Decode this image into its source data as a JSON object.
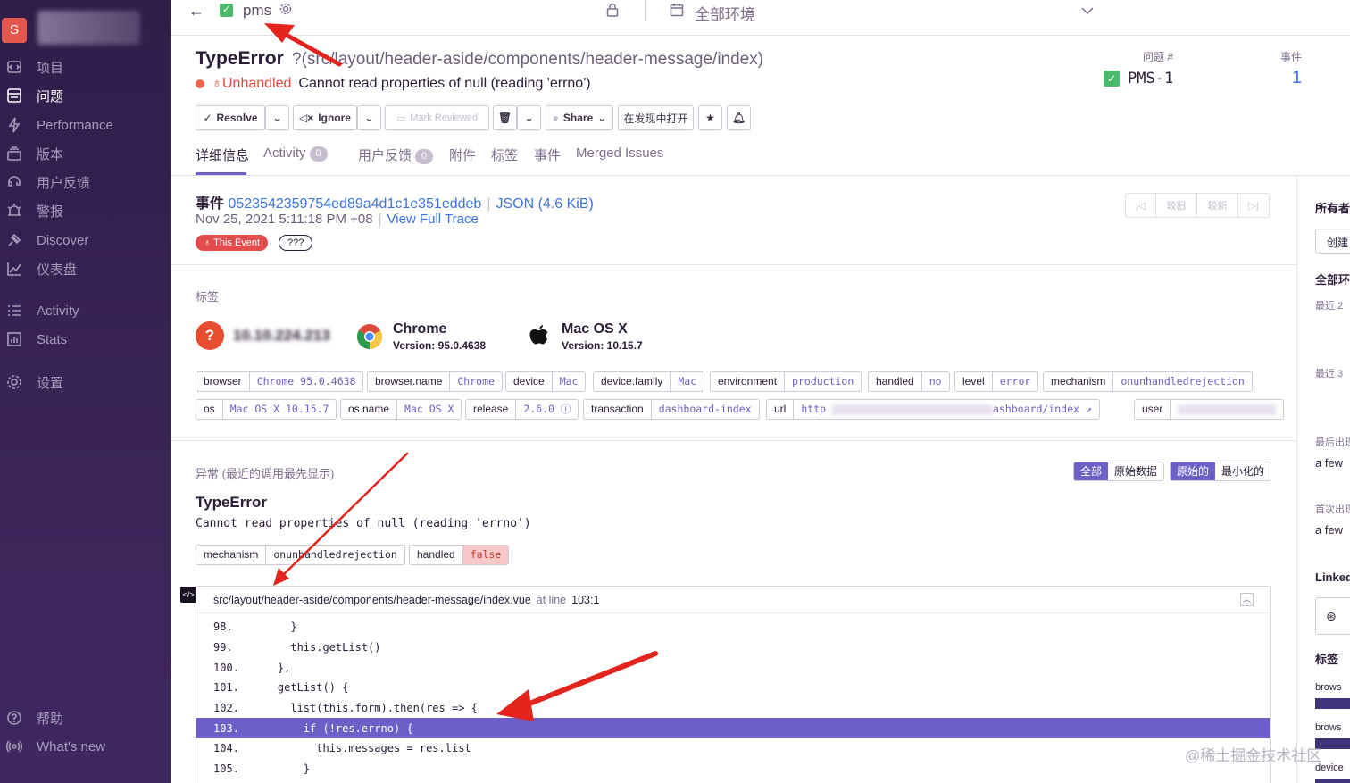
{
  "sidebar": {
    "org_initial": "S",
    "items": [
      {
        "label": "项目",
        "icon": "projects-icon"
      },
      {
        "label": "问题",
        "icon": "issues-icon",
        "active": true
      },
      {
        "label": "Performance",
        "icon": "performance-icon"
      },
      {
        "label": "版本",
        "icon": "releases-icon"
      },
      {
        "label": "用户反馈",
        "icon": "user-feedback-icon"
      },
      {
        "label": "警报",
        "icon": "alerts-icon"
      },
      {
        "label": "Discover",
        "icon": "discover-icon"
      },
      {
        "label": "仪表盘",
        "icon": "dashboards-icon"
      },
      {
        "label": "Activity",
        "icon": "activity-icon"
      },
      {
        "label": "Stats",
        "icon": "stats-icon"
      },
      {
        "label": "设置",
        "icon": "settings-icon"
      },
      {
        "label": "帮助",
        "icon": "help-icon"
      },
      {
        "label": "What's new",
        "icon": "broadcast-icon"
      }
    ]
  },
  "topbar": {
    "project": "pms",
    "environment": "全部环境"
  },
  "issue": {
    "type": "TypeError",
    "path": "?(src/layout/header-aside/components/header-message/index)",
    "status": "Unhandled",
    "message": "Cannot read properties of null (reading 'errno')",
    "issue_no_label": "问题 #",
    "issue_no": "PMS-1",
    "events_label": "事件",
    "events": "1"
  },
  "actions": {
    "resolve": "Resolve",
    "ignore": "Ignore",
    "mark_reviewed": "Mark Reviewed",
    "share": "Share",
    "open_discover": "在发现中打开"
  },
  "tabs": {
    "details": "详细信息",
    "activity": "Activity",
    "activity_count": "0",
    "feedback": "用户反馈",
    "feedback_count": "0",
    "attachments": "附件",
    "tags": "标签",
    "events": "事件",
    "merged": "Merged Issues"
  },
  "event": {
    "label": "事件",
    "id": "0523542359754ed89a4d1c1e351eddeb",
    "json": "JSON (4.6 KiB)",
    "date": "Nov 25, 2021 5:11:18 PM +08",
    "trace": "View Full Trace",
    "this_event": "This Event",
    "unknown": "???",
    "pager": [
      "较旧",
      "较新"
    ]
  },
  "tags_section": {
    "title": "标签",
    "ip": "10.10.224.213",
    "browser_name": "Chrome",
    "browser_version": "Version: 95.0.4638",
    "os_name": "Mac OS X",
    "os_version": "Version: 10.15.7",
    "row1": [
      {
        "k": "browser",
        "v": "Chrome 95.0.4638"
      },
      {
        "k": "browser.name",
        "v": "Chrome"
      },
      {
        "k": "device",
        "v": "Mac"
      },
      {
        "k": "device.family",
        "v": "Mac"
      },
      {
        "k": "environment",
        "v": "production"
      },
      {
        "k": "handled",
        "v": "no"
      },
      {
        "k": "level",
        "v": "error"
      },
      {
        "k": "mechanism",
        "v": "onunhandledrejection"
      }
    ],
    "row2": [
      {
        "k": "os",
        "v": "Mac OS X 10.15.7"
      },
      {
        "k": "os.name",
        "v": "Mac OS X"
      },
      {
        "k": "release",
        "v": "2.6.0"
      },
      {
        "k": "transaction",
        "v": "dashboard-index"
      },
      {
        "k": "url",
        "v": "http",
        "v2": "ashboard/index"
      },
      {
        "k": "user",
        "v": ""
      }
    ]
  },
  "exception": {
    "title": "异常 (最近的调用最先显示)",
    "btn_all": "全部",
    "btn_raw": "原始数据",
    "btn_original": "原始的",
    "btn_minified": "最小化的",
    "type": "TypeError",
    "message": "Cannot read properties of null (reading 'errno')",
    "mech_k": "mechanism",
    "mech_v": "onunhandledrejection",
    "handled_k": "handled",
    "handled_v": "false",
    "frame_file": "src/layout/header-aside/components/header-message/index.vue",
    "frame_at": "at line",
    "frame_line": "103:1",
    "lines": [
      {
        "n": "98.",
        "code": "      }"
      },
      {
        "n": "99.",
        "code": "      this.getList()"
      },
      {
        "n": "100.",
        "code": "    },"
      },
      {
        "n": "101.",
        "code": "    getList() {"
      },
      {
        "n": "102.",
        "code": "      list(this.form).then(res => {"
      },
      {
        "n": "103.",
        "code": "        if (!res.errno) {",
        "hl": true
      },
      {
        "n": "104.",
        "code": "          this.messages = res.list"
      },
      {
        "n": "105.",
        "code": "        }"
      }
    ]
  },
  "right_panel": {
    "owners": "所有者",
    "create": "创建",
    "all_env": "全部环境",
    "recent1": "最近 2",
    "recent2": "最近 3",
    "last_seen": "最后出现",
    "last_seen_val": "a few",
    "first_seen": "首次出现",
    "first_seen_val": "a few",
    "linked": "Linked",
    "tags": "标签",
    "tag1": "brows",
    "tag2": "brows",
    "tag3": "device"
  },
  "watermark": "@稀土掘金技术社区",
  "colors": {
    "accent": "#6c5fc7",
    "sidebar": "#2f1d4a",
    "danger": "#e24c4c",
    "link": "#3d74db",
    "annotation_arrow": "#e3241d"
  }
}
